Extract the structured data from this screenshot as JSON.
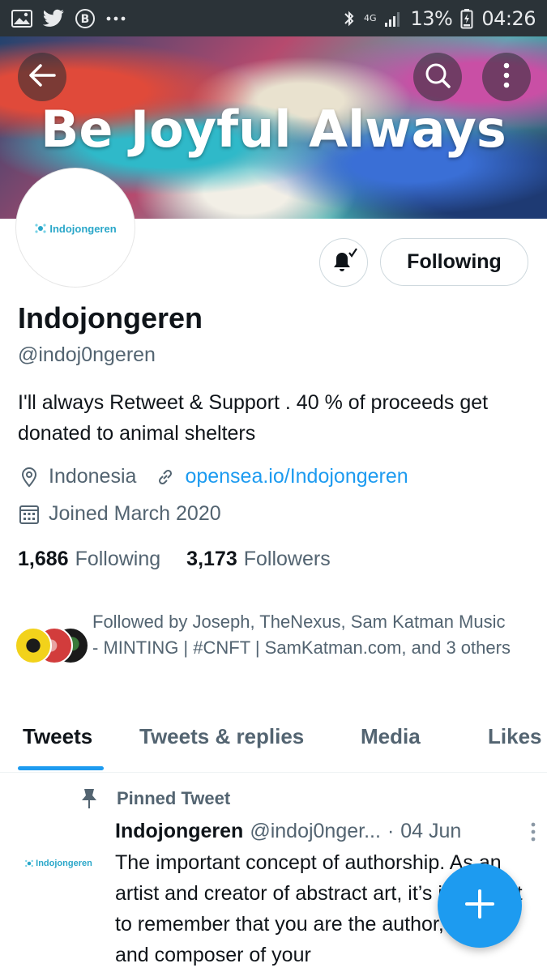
{
  "status_bar": {
    "icons_left": [
      "image-icon",
      "twitter-icon",
      "b-icon",
      "more-icon"
    ],
    "network": "4G",
    "battery": "13%",
    "time": "04:26"
  },
  "banner": {
    "title": "Be Joyful Always"
  },
  "profile": {
    "avatar_text": "Indojongeren",
    "follow_button": "Following",
    "name": "Indojongeren",
    "handle": "@indoj0ngeren",
    "bio": "I'll always Retweet & Support . 40 % of proceeds get donated to animal shelters",
    "location": "Indonesia",
    "website": "opensea.io/Indojongeren",
    "joined": "Joined March 2020",
    "following_count": "1,686",
    "following_label": "Following",
    "followers_count": "3,173",
    "followers_label": "Followers",
    "followed_by": "Followed by Joseph, TheNexus, Sam Katman Music - MINTING | #CNFT | SamKatman.com, and 3 others"
  },
  "tabs": [
    {
      "label": "Tweets",
      "active": true
    },
    {
      "label": "Tweets & replies",
      "active": false
    },
    {
      "label": "Media",
      "active": false
    },
    {
      "label": "Likes",
      "active": false
    }
  ],
  "pinned_tweet": {
    "pin_label": "Pinned Tweet",
    "avatar_text": "Indojongeren",
    "author": "Indojongeren",
    "handle": "@indoj0nger...",
    "separator": "·",
    "date": "04 Jun",
    "body": "The important concept of authorship. As an artist and creator of abstract art, it’s important to remember that you are the author, artist and composer of your"
  },
  "colors": {
    "accent": "#1d9bf0",
    "status_bar": "#2b3338",
    "secondary_text": "#536471"
  }
}
